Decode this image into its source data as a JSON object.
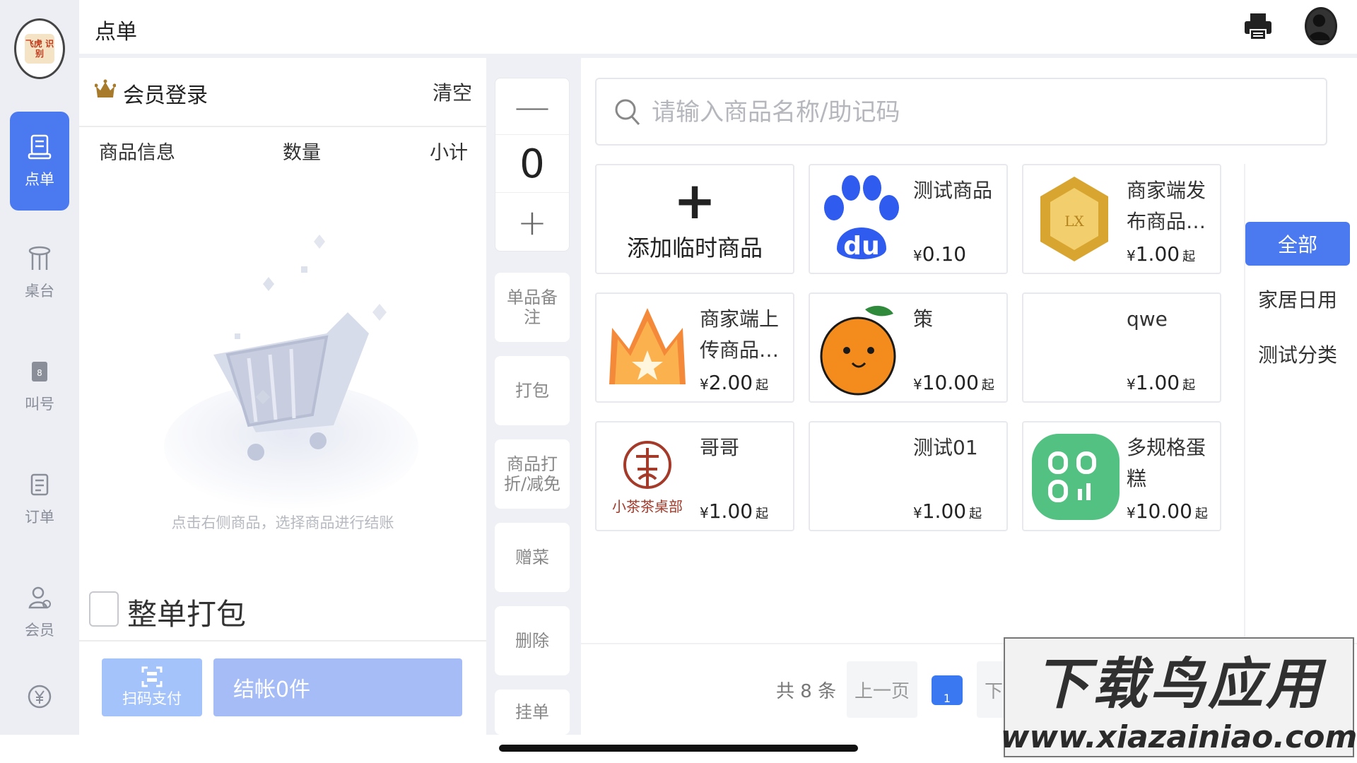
{
  "app": {
    "page_title": "点单",
    "logo_text": "飞虎\n识别"
  },
  "nav": {
    "items": [
      {
        "label": "点单",
        "icon": "order-icon",
        "active": true
      },
      {
        "label": "桌台",
        "icon": "table-icon",
        "active": false
      },
      {
        "label": "叫号",
        "icon": "call-number-icon",
        "active": false
      },
      {
        "label": "订单",
        "icon": "orders-list-icon",
        "active": false
      },
      {
        "label": "会员",
        "icon": "member-icon",
        "active": false
      },
      {
        "label": "",
        "icon": "yen-icon",
        "active": false
      }
    ]
  },
  "cart": {
    "member_login": "会员登录",
    "clear": "清空",
    "headers": {
      "info": "商品信息",
      "qty": "数量",
      "subtotal": "小计"
    },
    "empty_hint": "点击右侧商品，选择商品进行结账",
    "pack_all": "整单打包",
    "scan_pay": "扫码支付",
    "checkout": "结帐0件"
  },
  "actions": {
    "minus": "—",
    "quantity": "0",
    "plus": "+",
    "note": "单品备注",
    "pack": "打包",
    "discount": "商品打折/减免",
    "gift": "赠菜",
    "delete": "删除",
    "hold": "挂单"
  },
  "search": {
    "placeholder": "请输入商品名称/助记码",
    "value": ""
  },
  "products": [
    {
      "name": "添加临时商品",
      "type": "add"
    },
    {
      "name": "测试商品",
      "price": "0.10",
      "suffix": "",
      "image": "baidu-paw"
    },
    {
      "name": "商家端发布商品…",
      "price": "1.00",
      "suffix": "起",
      "image": "gold-hexagon"
    },
    {
      "name": "商家端上传商品…",
      "price": "2.00",
      "suffix": "起",
      "image": "orange-crown"
    },
    {
      "name": "策",
      "price": "10.00",
      "suffix": "起",
      "image": "orange-fruit"
    },
    {
      "name": "qwe",
      "price": "1.00",
      "suffix": "起",
      "image": "none"
    },
    {
      "name": "哥哥",
      "price": "1.00",
      "suffix": "起",
      "image": "tea-logo",
      "image_text": "小茶茶桌部"
    },
    {
      "name": "测试01",
      "price": "1.00",
      "suffix": "起",
      "image": "none"
    },
    {
      "name": "多规格蛋糕",
      "price": "10.00",
      "suffix": "起",
      "image": "green-tile"
    }
  ],
  "currency": "¥",
  "categories": [
    {
      "label": "全部",
      "active": true
    },
    {
      "label": "家居日用",
      "active": false
    },
    {
      "label": "测试分类",
      "active": false
    }
  ],
  "pager": {
    "total": "共 8 条",
    "prev": "上一页",
    "page": "1",
    "next": "下一页"
  },
  "watermark": {
    "main": "下载鸟应用",
    "url": "www.xiazainiao.com"
  },
  "colors": {
    "accent": "#4a79f0",
    "checkout_bg": "#a6bcf7",
    "scan_bg": "#a4c3fb",
    "page_bg": "#eef0f5"
  }
}
